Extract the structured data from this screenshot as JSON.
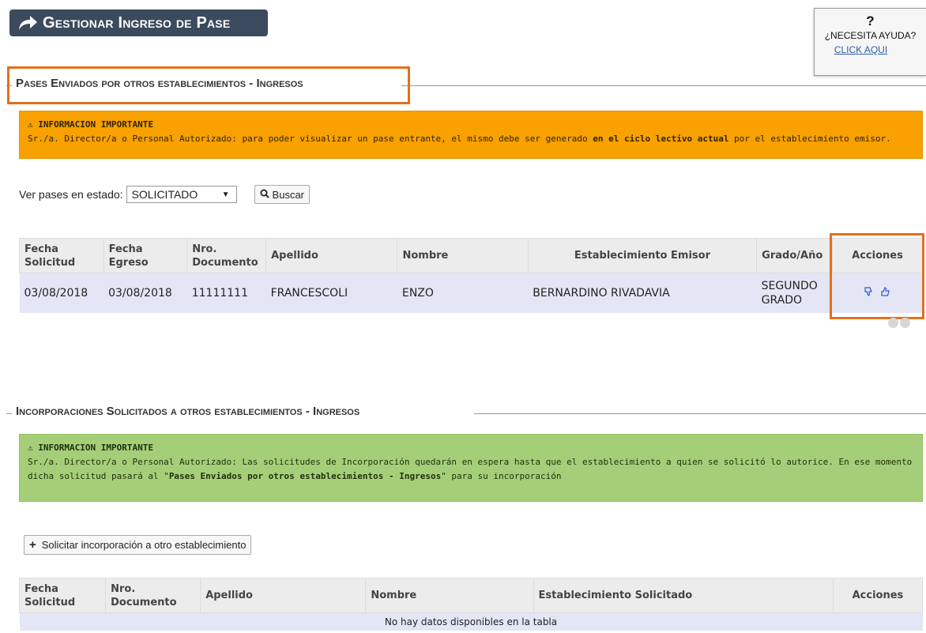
{
  "header": {
    "title": "Gestionar Ingreso de Pase"
  },
  "help": {
    "icon": "question-icon",
    "question": "?",
    "text": "¿NECESITA AYUDA?",
    "link": "CLICK AQUI"
  },
  "section1": {
    "legend": "Pases Enviados por otros establecimientos - Ingresos",
    "alert": {
      "header": "⚠ INFORMACION IMPORTANTE",
      "text_before": "Sr./a. Director/a o Personal Autorizado: para poder visualizar un pase entrante, el mismo debe ser generado ",
      "text_bold": "en el ciclo lectivo actual",
      "text_after": " por el establecimiento emisor.",
      "color": "#f8a100"
    },
    "filter": {
      "label": "Ver pases en estado:",
      "selected": "SOLICITADO",
      "search_label": "Buscar"
    },
    "table": {
      "headers": [
        "Fecha Solicitud",
        "Fecha Egreso",
        "Nro. Documento",
        "Apellido",
        "Nombre",
        "Establecimiento Emisor",
        "Grado/Año",
        "Acciones"
      ],
      "rows": [
        {
          "fecha_solicitud": "03/08/2018",
          "fecha_egreso": "03/08/2018",
          "documento": "11111111",
          "apellido": "FRANCESCOLI",
          "nombre": "ENZO",
          "establecimiento": "BERNARDINO RIVADAVIA",
          "grado": "SEGUNDO GRADO",
          "actions": [
            "thumbs-down-icon",
            "thumbs-up-icon"
          ]
        }
      ]
    }
  },
  "section2": {
    "legend": "Incorporaciones Solicitados a otros establecimientos - Ingresos",
    "alert": {
      "header": "⚠ INFORMACION IMPORTANTE",
      "text_before": "Sr./a. Director/a o Personal Autorizado: Las solicitudes de Incorporación quedarán en espera hasta que el establecimiento a quien se solicitó lo autorice. En ese momento dicha solicitud pasará al \"",
      "text_bold": "Pases Enviados por otros establecimientos - Ingresos",
      "text_after": "\" para su incorporación",
      "color": "#a4cf78"
    },
    "button": "Solicitar incorporación a otro establecimiento",
    "table": {
      "headers": [
        "Fecha Solicitud",
        "Nro. Documento",
        "Apellido",
        "Nombre",
        "Establecimiento Solicitado",
        "Acciones"
      ],
      "empty": "No hay datos disponibles en la tabla"
    }
  }
}
